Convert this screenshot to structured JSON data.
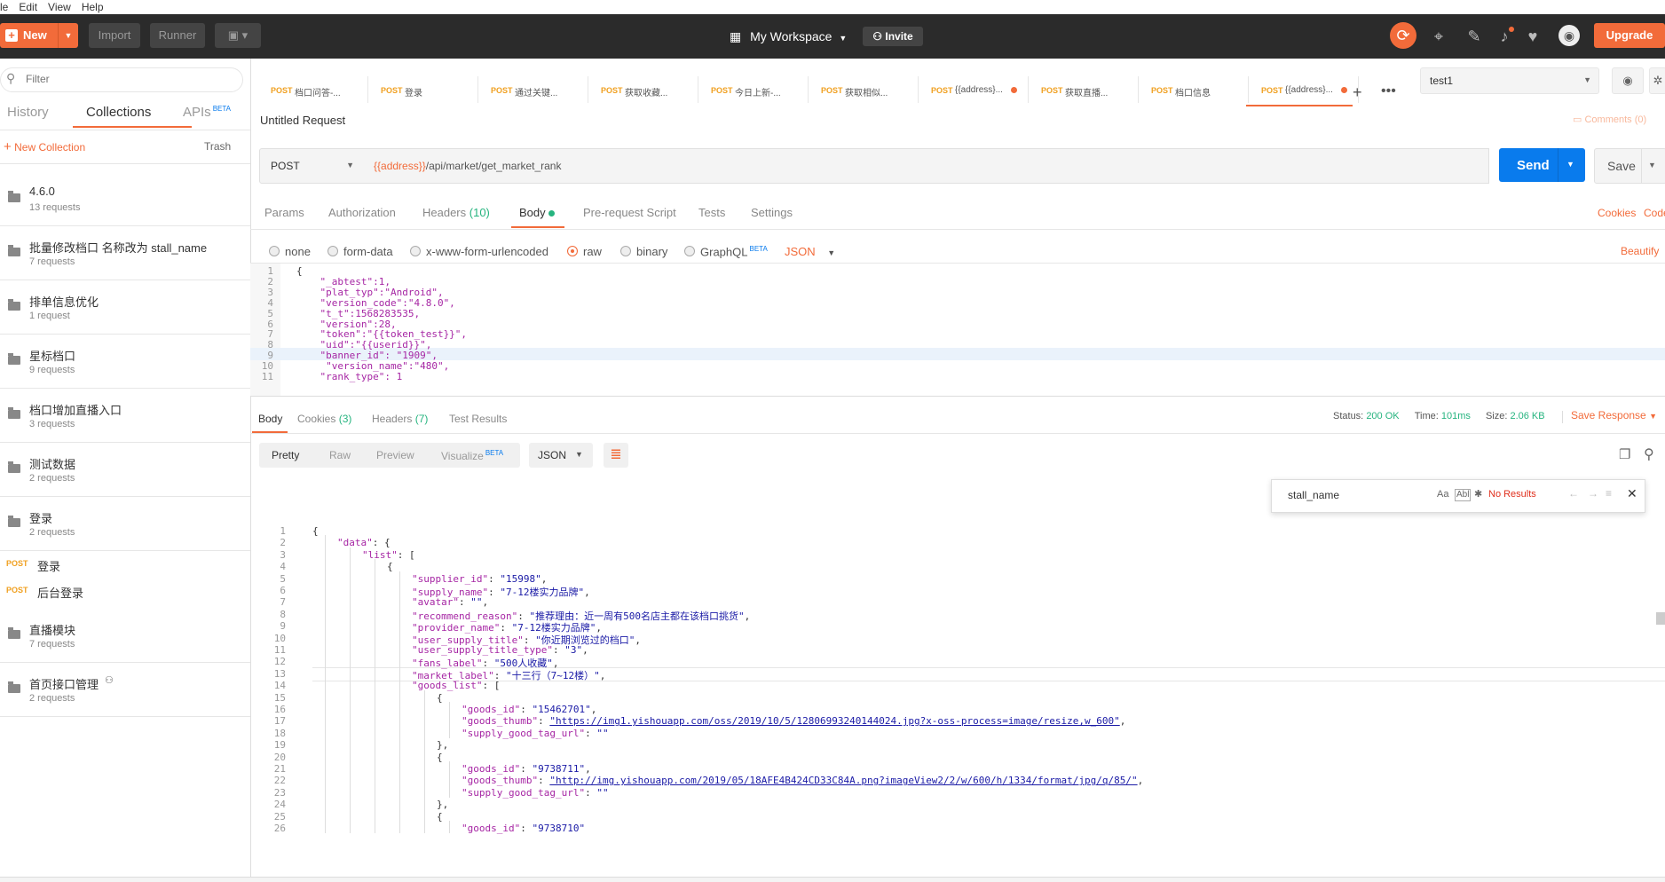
{
  "menu": [
    "le",
    "Edit",
    "View",
    "Help"
  ],
  "header": {
    "new_label": "New",
    "import_label": "Import",
    "runner_label": "Runner",
    "workspace_label": "My Workspace",
    "invite_label": "Invite",
    "upgrade_label": "Upgrade"
  },
  "sidebar": {
    "filter_placeholder": "Filter",
    "tabs": [
      "History",
      "Collections",
      "APIs"
    ],
    "apis_badge": "BETA",
    "new_collection_label": "New Collection",
    "trash_label": "Trash",
    "collections": [
      {
        "name": "4.6.0",
        "count": "13 requests"
      },
      {
        "name": "批量修改档口 名称改为 stall_name",
        "count": "7 requests"
      },
      {
        "name": "排单信息优化",
        "count": "1 request"
      },
      {
        "name": "星标档口",
        "count": "9 requests"
      },
      {
        "name": "档口增加直播入口",
        "count": "3 requests"
      },
      {
        "name": "测试数据",
        "count": "2 requests"
      },
      {
        "name": "登录",
        "count": "2 requests"
      }
    ],
    "requests": [
      {
        "method": "POST",
        "name": "登录"
      },
      {
        "method": "POST",
        "name": "后台登录"
      }
    ],
    "collections2": [
      {
        "name": "直播模块",
        "count": "7 requests"
      },
      {
        "name": "首页接口管理",
        "count": "2 requests"
      }
    ]
  },
  "tabs": [
    {
      "method": "POST",
      "title": "档口问答-...",
      "dot": false
    },
    {
      "method": "POST",
      "title": "登录",
      "dot": false
    },
    {
      "method": "POST",
      "title": "通过关键...",
      "dot": false
    },
    {
      "method": "POST",
      "title": "获取收藏...",
      "dot": false
    },
    {
      "method": "POST",
      "title": "今日上新-...",
      "dot": false
    },
    {
      "method": "POST",
      "title": "获取相似...",
      "dot": false
    },
    {
      "method": "POST",
      "title": "{{address}...",
      "dot": true
    },
    {
      "method": "POST",
      "title": "获取直播...",
      "dot": false
    },
    {
      "method": "POST",
      "title": "档口信息",
      "dot": false
    },
    {
      "method": "POST",
      "title": "{{address}...",
      "dot": true
    }
  ],
  "environment": "test1",
  "request": {
    "title": "Untitled Request",
    "comments_label": "Comments (0)",
    "method": "POST",
    "url_var": "{{address}}",
    "url_path": "/api/market/get_market_rank",
    "send_label": "Send",
    "save_label": "Save"
  },
  "req_tabs": {
    "params": "Params",
    "authorization": "Authorization",
    "headers": "Headers",
    "headers_count": "(10)",
    "body": "Body",
    "prerequest": "Pre-request Script",
    "tests": "Tests",
    "settings": "Settings",
    "cookies": "Cookies",
    "code": "Code"
  },
  "body_types": {
    "none": "none",
    "form_data": "form-data",
    "urlencoded": "x-www-form-urlencoded",
    "raw": "raw",
    "binary": "binary",
    "graphql": "GraphQL",
    "graphql_badge": "BETA",
    "format": "JSON",
    "beautify": "Beautify"
  },
  "request_body": [
    {
      "n": "1",
      "text": "{"
    },
    {
      "n": "2",
      "text": "    \"_abtest\":1,"
    },
    {
      "n": "3",
      "text": "    \"plat_typ\":\"Android\","
    },
    {
      "n": "4",
      "text": "    \"version_code\":\"4.8.0\","
    },
    {
      "n": "5",
      "text": "    \"t_t\":1568283535,"
    },
    {
      "n": "6",
      "text": "    \"version\":28,"
    },
    {
      "n": "7",
      "text": "    \"token\":\"{{token_test}}\","
    },
    {
      "n": "8",
      "text": "    \"uid\":\"{{userid}}\","
    },
    {
      "n": "9",
      "text": "    \"banner_id\": \"1909\","
    },
    {
      "n": "10",
      "text": "     \"version_name\":\"480\","
    },
    {
      "n": "11",
      "text": "    \"rank_type\": 1"
    }
  ],
  "resp_tabs": {
    "body": "Body",
    "cookies": "Cookies",
    "cookies_count": "(3)",
    "headers": "Headers",
    "headers_count": "(7)",
    "test_results": "Test Results",
    "status_label": "Status:",
    "status_value": "200 OK",
    "time_label": "Time:",
    "time_value": "101ms",
    "size_label": "Size:",
    "size_value": "2.06 KB",
    "save_response": "Save Response"
  },
  "view_modes": {
    "pretty": "Pretty",
    "raw": "Raw",
    "preview": "Preview",
    "visualize": "Visualize",
    "visualize_badge": "BETA",
    "format": "JSON"
  },
  "search": {
    "value": "stall_name",
    "case_label": "Aa",
    "word_label": "Abl",
    "no_results": "No Results"
  },
  "response_body": [
    {
      "n": "1",
      "indent": 0,
      "parts": [
        [
          "p",
          "{"
        ]
      ]
    },
    {
      "n": "2",
      "indent": 1,
      "parts": [
        [
          "k",
          "\"data\""
        ],
        [
          "p",
          ": {"
        ]
      ]
    },
    {
      "n": "3",
      "indent": 2,
      "parts": [
        [
          "k",
          "\"list\""
        ],
        [
          "p",
          ": ["
        ]
      ]
    },
    {
      "n": "4",
      "indent": 3,
      "parts": [
        [
          "p",
          "{"
        ]
      ]
    },
    {
      "n": "5",
      "indent": 4,
      "parts": [
        [
          "k",
          "\"supplier_id\""
        ],
        [
          "p",
          ": "
        ],
        [
          "s",
          "\"15998\""
        ],
        [
          "p",
          ","
        ]
      ]
    },
    {
      "n": "6",
      "indent": 4,
      "parts": [
        [
          "k",
          "\"supply_name\""
        ],
        [
          "p",
          ": "
        ],
        [
          "s",
          "\"7-12楼实力品牌\""
        ],
        [
          "p",
          ","
        ]
      ]
    },
    {
      "n": "7",
      "indent": 4,
      "parts": [
        [
          "k",
          "\"avatar\""
        ],
        [
          "p",
          ": "
        ],
        [
          "s",
          "\"\""
        ],
        [
          "p",
          ","
        ]
      ]
    },
    {
      "n": "8",
      "indent": 4,
      "parts": [
        [
          "k",
          "\"recommend_reason\""
        ],
        [
          "p",
          ": "
        ],
        [
          "s",
          "\"推荐理由：近一周有500名店主都在该档口挑货\""
        ],
        [
          "p",
          ","
        ]
      ]
    },
    {
      "n": "9",
      "indent": 4,
      "parts": [
        [
          "k",
          "\"provider_name\""
        ],
        [
          "p",
          ": "
        ],
        [
          "s",
          "\"7-12楼实力品牌\""
        ],
        [
          "p",
          ","
        ]
      ]
    },
    {
      "n": "10",
      "indent": 4,
      "parts": [
        [
          "k",
          "\"user_supply_title\""
        ],
        [
          "p",
          ": "
        ],
        [
          "s",
          "\"你近期浏览过的档口\""
        ],
        [
          "p",
          ","
        ]
      ]
    },
    {
      "n": "11",
      "indent": 4,
      "parts": [
        [
          "k",
          "\"user_supply_title_type\""
        ],
        [
          "p",
          ": "
        ],
        [
          "s",
          "\"3\""
        ],
        [
          "p",
          ","
        ]
      ]
    },
    {
      "n": "12",
      "indent": 4,
      "parts": [
        [
          "k",
          "\"fans_label\""
        ],
        [
          "p",
          ": "
        ],
        [
          "s",
          "\"500人收藏\""
        ],
        [
          "p",
          ","
        ]
      ]
    },
    {
      "n": "13",
      "indent": 4,
      "parts": [
        [
          "k",
          "\"market_label\""
        ],
        [
          "p",
          ": "
        ],
        [
          "s",
          "\"十三行（7~12楼）\""
        ],
        [
          "p",
          ","
        ]
      ]
    },
    {
      "n": "14",
      "indent": 4,
      "parts": [
        [
          "k",
          "\"goods_list\""
        ],
        [
          "p",
          ": ["
        ]
      ]
    },
    {
      "n": "15",
      "indent": 5,
      "parts": [
        [
          "p",
          "{"
        ]
      ]
    },
    {
      "n": "16",
      "indent": 6,
      "parts": [
        [
          "k",
          "\"goods_id\""
        ],
        [
          "p",
          ": "
        ],
        [
          "s",
          "\"15462701\""
        ],
        [
          "p",
          ","
        ]
      ]
    },
    {
      "n": "17",
      "indent": 6,
      "parts": [
        [
          "k",
          "\"goods_thumb\""
        ],
        [
          "p",
          ": "
        ],
        [
          "u",
          "\"https://img1.yishouapp.com/oss/2019/10/5/12806993240144024.jpg?x-oss-process=image/resize,w_600\""
        ],
        [
          "p",
          ","
        ]
      ]
    },
    {
      "n": "18",
      "indent": 6,
      "parts": [
        [
          "k",
          "\"supply_good_tag_url\""
        ],
        [
          "p",
          ": "
        ],
        [
          "s",
          "\"\""
        ]
      ]
    },
    {
      "n": "19",
      "indent": 5,
      "parts": [
        [
          "p",
          "},"
        ]
      ]
    },
    {
      "n": "20",
      "indent": 5,
      "parts": [
        [
          "p",
          "{"
        ]
      ]
    },
    {
      "n": "21",
      "indent": 6,
      "parts": [
        [
          "k",
          "\"goods_id\""
        ],
        [
          "p",
          ": "
        ],
        [
          "s",
          "\"9738711\""
        ],
        [
          "p",
          ","
        ]
      ]
    },
    {
      "n": "22",
      "indent": 6,
      "parts": [
        [
          "k",
          "\"goods_thumb\""
        ],
        [
          "p",
          ": "
        ],
        [
          "u",
          "\"http://img.yishouapp.com/2019/05/18AFE4B424CD33C84A.png?imageView2/2/w/600/h/1334/format/jpg/q/85/\""
        ],
        [
          "p",
          ","
        ]
      ]
    },
    {
      "n": "23",
      "indent": 6,
      "parts": [
        [
          "k",
          "\"supply_good_tag_url\""
        ],
        [
          "p",
          ": "
        ],
        [
          "s",
          "\"\""
        ]
      ]
    },
    {
      "n": "24",
      "indent": 5,
      "parts": [
        [
          "p",
          "},"
        ]
      ]
    },
    {
      "n": "25",
      "indent": 5,
      "parts": [
        [
          "p",
          "{"
        ]
      ]
    },
    {
      "n": "26",
      "indent": 6,
      "parts": [
        [
          "k",
          "\"goods_id\""
        ],
        [
          "p",
          ": "
        ],
        [
          "s",
          "\"9738710\""
        ]
      ]
    }
  ]
}
